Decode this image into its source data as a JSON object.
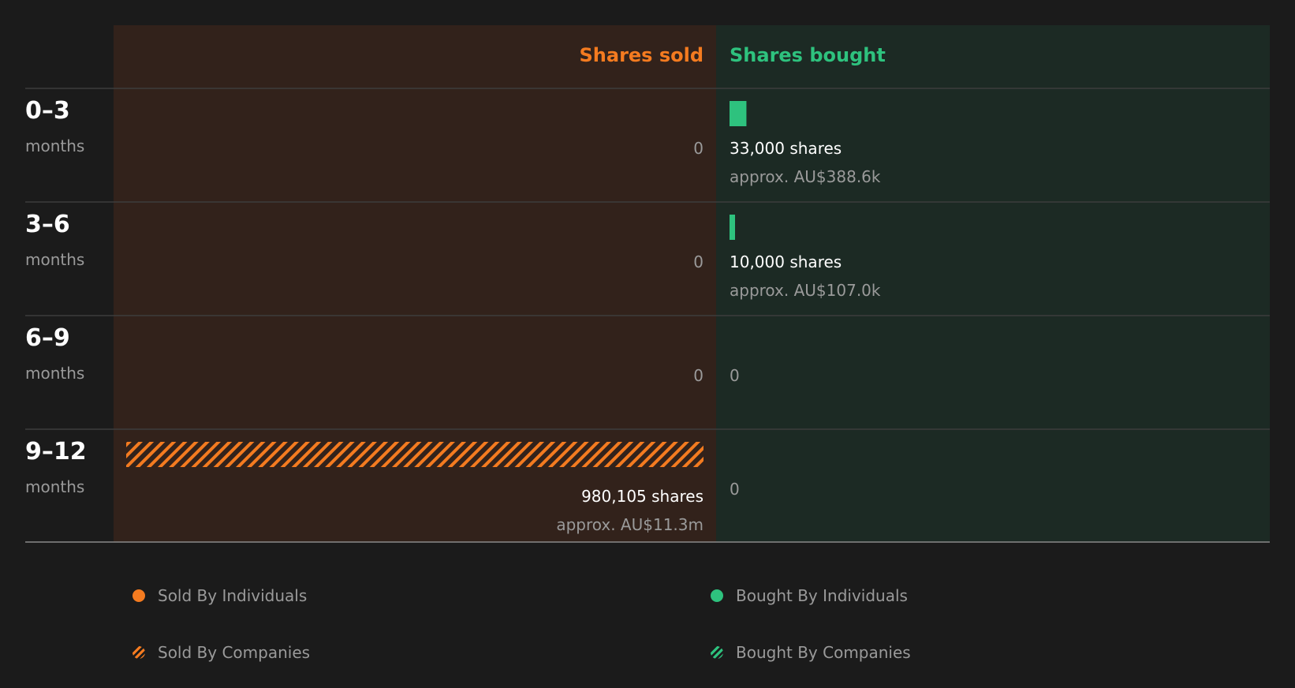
{
  "columns": {
    "sold_label": "Shares sold",
    "bought_label": "Shares bought"
  },
  "colors": {
    "sold": "#f47b20",
    "bought": "#2ec27e",
    "sold_bg": "#32221b",
    "bought_bg": "#1c2a24",
    "text_primary": "#ffffff",
    "text_muted": "#9a9a9a",
    "background": "#1b1b1b"
  },
  "legend": {
    "sold_individuals": "Sold By Individuals",
    "bought_individuals": "Bought By Individuals",
    "sold_companies": "Sold By Companies",
    "bought_companies": "Bought By Companies"
  },
  "chart_data": {
    "type": "bar",
    "orientation": "horizontal-diverging",
    "categories": [
      {
        "range": "0–3",
        "unit": "months"
      },
      {
        "range": "3–6",
        "unit": "months"
      },
      {
        "range": "6–9",
        "unit": "months"
      },
      {
        "range": "9–12",
        "unit": "months"
      }
    ],
    "series": [
      {
        "name": "Shares sold",
        "values": [
          0,
          0,
          0,
          980105
        ],
        "labels": [
          "0",
          "0",
          "0",
          "980,105 shares"
        ],
        "approx": [
          "",
          "",
          "",
          "approx. AU$11.3m"
        ],
        "holder_type": [
          "",
          "",
          "",
          "companies"
        ]
      },
      {
        "name": "Shares bought",
        "values": [
          33000,
          10000,
          0,
          0
        ],
        "labels": [
          "33,000 shares",
          "10,000 shares",
          "0",
          "0"
        ],
        "approx": [
          "approx. AU$388.6k",
          "approx. AU$107.0k",
          "",
          ""
        ],
        "holder_type": [
          "individuals",
          "individuals",
          "",
          ""
        ]
      }
    ],
    "max_value": 980105
  }
}
